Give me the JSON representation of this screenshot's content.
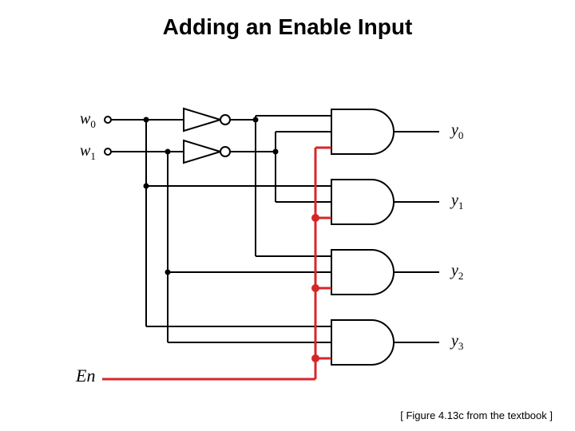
{
  "title": "Adding an Enable Input",
  "caption": "[ Figure 4.13c from the textbook ]",
  "inputs": {
    "w0": "w",
    "w0_sub": "0",
    "w1": "w",
    "w1_sub": "1",
    "en": "En"
  },
  "outputs": {
    "y0": "y",
    "y0_sub": "0",
    "y1": "y",
    "y1_sub": "1",
    "y2": "y",
    "y2_sub": "2",
    "y3": "y",
    "y3_sub": "3"
  },
  "chart_data": {
    "type": "logic-circuit",
    "description": "2-to-4 decoder with enable input",
    "inputs": [
      "w0",
      "w1",
      "En"
    ],
    "outputs": [
      "y0",
      "y1",
      "y2",
      "y3"
    ],
    "gates": [
      {
        "id": "N0",
        "type": "NOT",
        "in": [
          "w0"
        ],
        "out": "w0_n"
      },
      {
        "id": "N1",
        "type": "NOT",
        "in": [
          "w1"
        ],
        "out": "w1_n"
      },
      {
        "id": "A0",
        "type": "AND3",
        "in": [
          "w0_n",
          "w1_n",
          "En"
        ],
        "out": "y0"
      },
      {
        "id": "A1",
        "type": "AND3",
        "in": [
          "w0",
          "w1_n",
          "En"
        ],
        "out": "y1"
      },
      {
        "id": "A2",
        "type": "AND3",
        "in": [
          "w0_n",
          "w1",
          "En"
        ],
        "out": "y2"
      },
      {
        "id": "A3",
        "type": "AND3",
        "in": [
          "w0",
          "w1",
          "En"
        ],
        "out": "y3"
      }
    ],
    "highlight": {
      "signal": "En",
      "color": "#d62728"
    }
  }
}
